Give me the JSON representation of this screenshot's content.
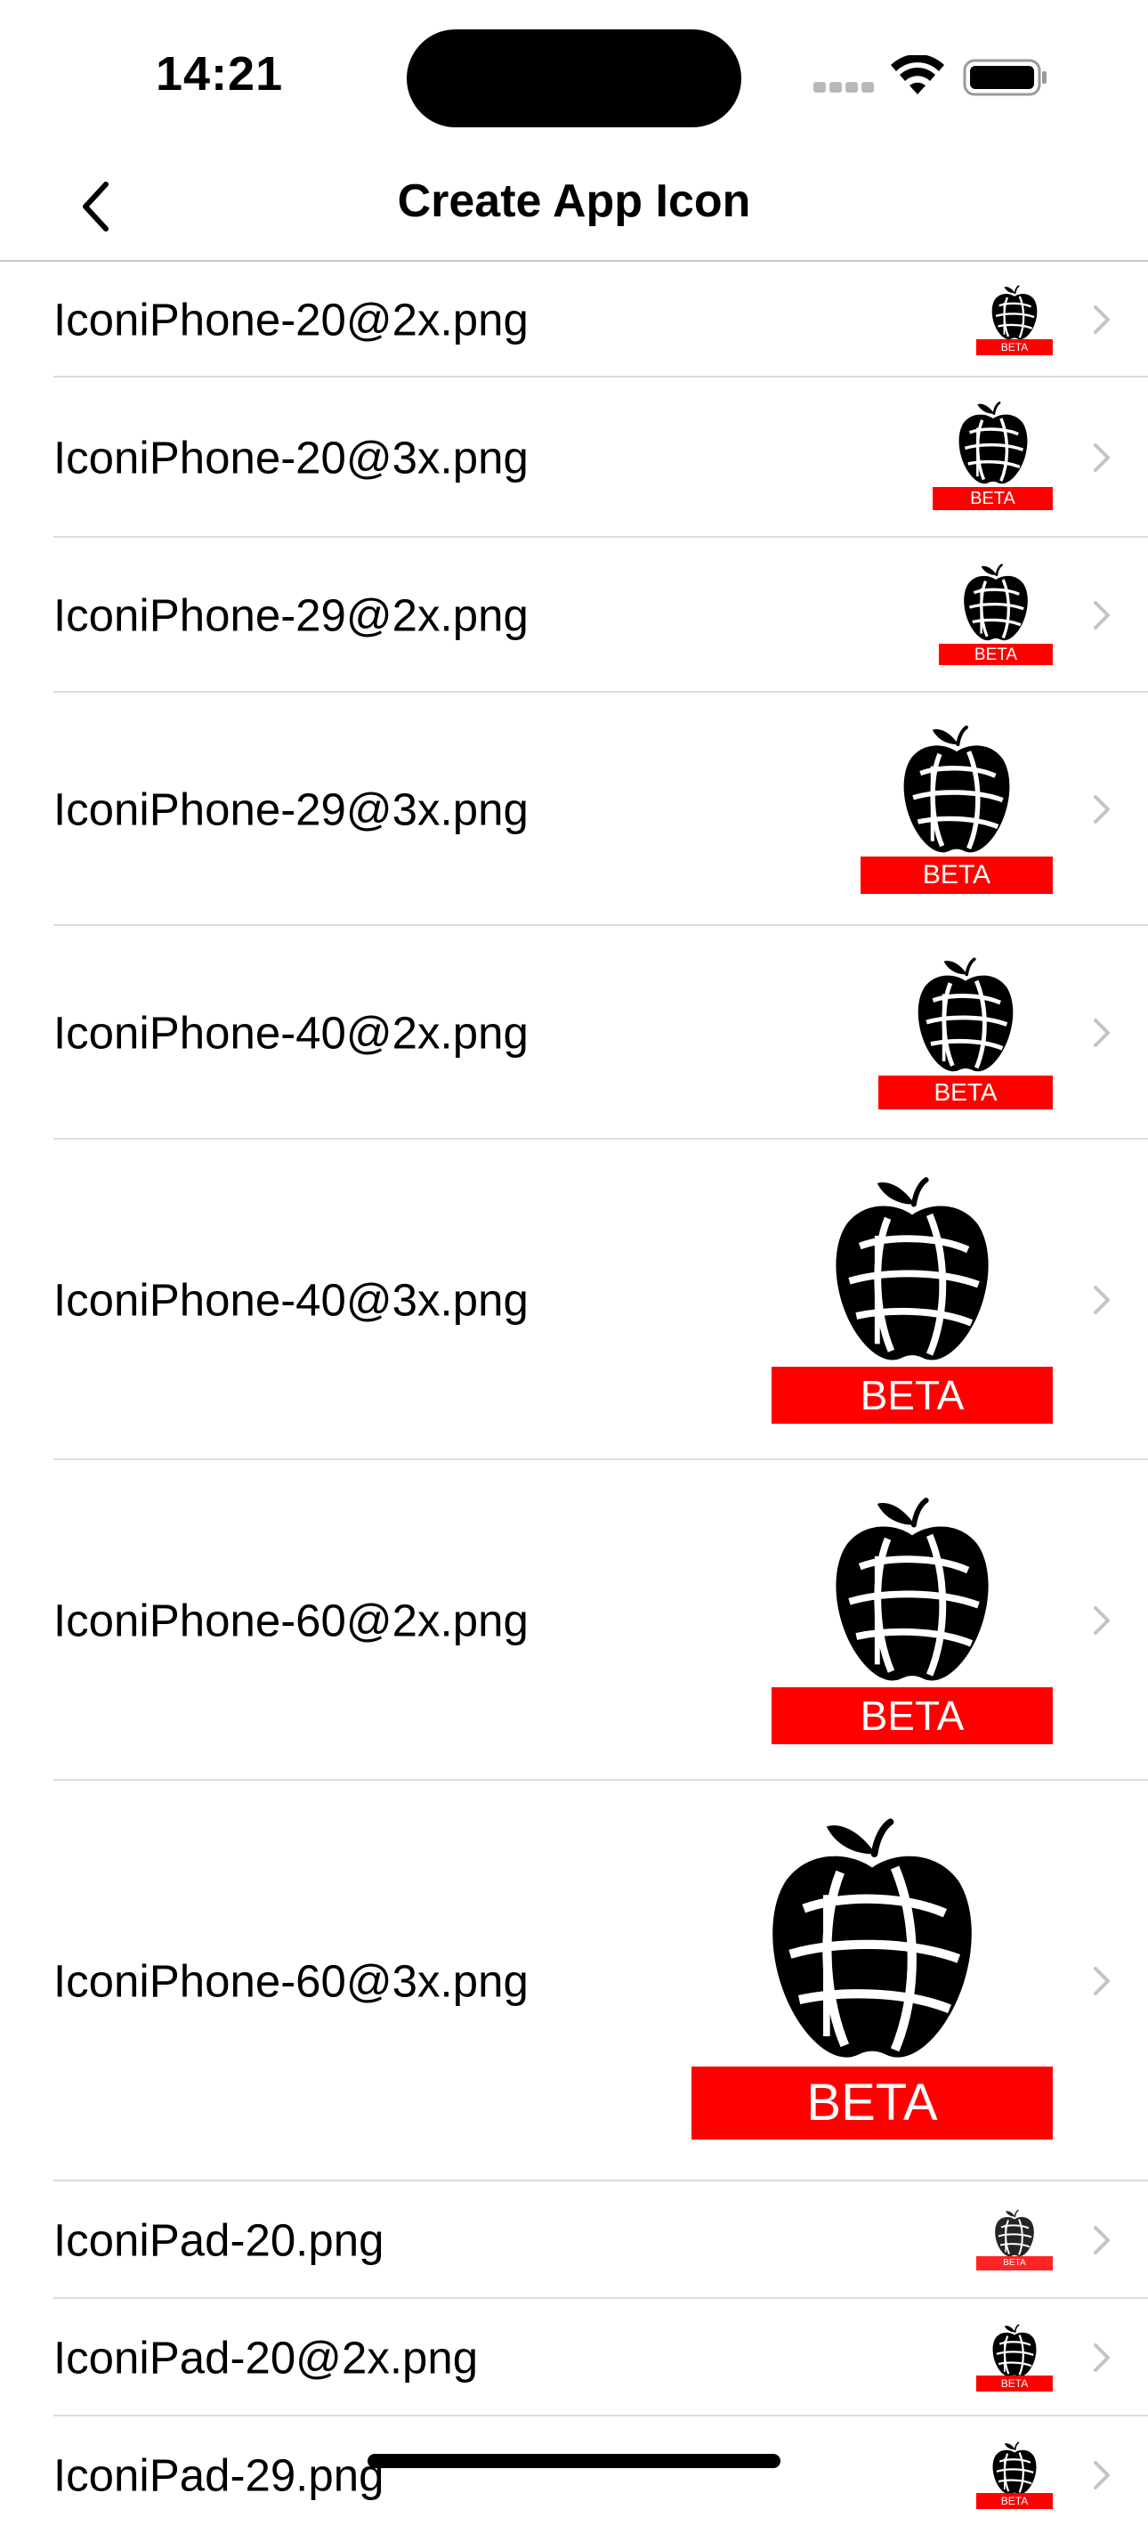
{
  "status_bar": {
    "time": "14:21"
  },
  "nav": {
    "title": "Create App Icon",
    "back_icon": "chevron-left-icon"
  },
  "icon_banner_text": "BETA",
  "rows": [
    {
      "label": "IconiPhone-20@2x.png"
    },
    {
      "label": "IconiPhone-20@3x.png"
    },
    {
      "label": "IconiPhone-29@2x.png"
    },
    {
      "label": "IconiPhone-29@3x.png"
    },
    {
      "label": "IconiPhone-40@2x.png"
    },
    {
      "label": "IconiPhone-40@3x.png"
    },
    {
      "label": "IconiPhone-60@2x.png"
    },
    {
      "label": "IconiPhone-60@3x.png"
    },
    {
      "label": "IconiPad-20.png"
    },
    {
      "label": "IconiPad-20@2x.png"
    },
    {
      "label": "IconiPad-29.png"
    }
  ],
  "colors": {
    "banner": "#ff0000",
    "separator": "#dcdcdf",
    "chevron": "#c4c4c7"
  }
}
